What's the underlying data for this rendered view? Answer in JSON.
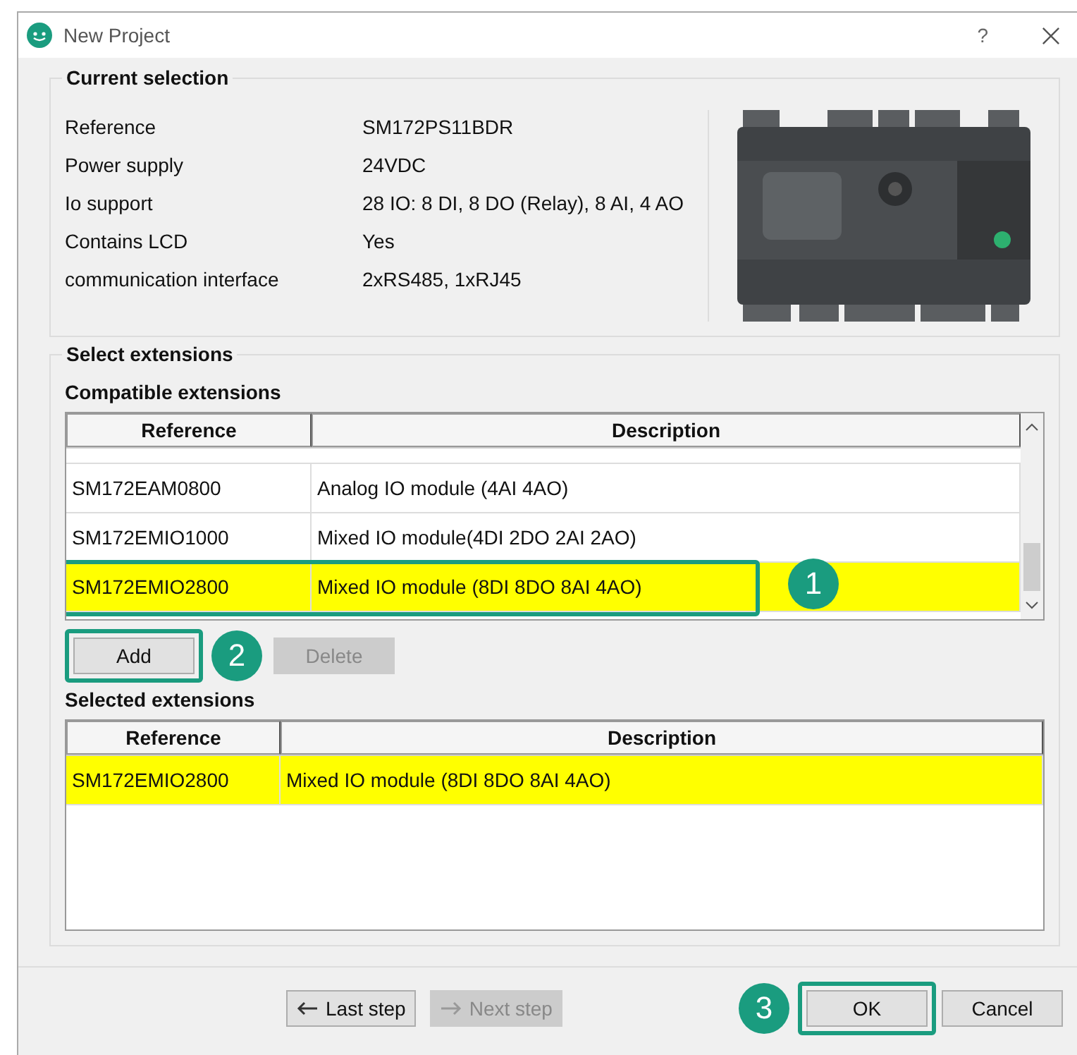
{
  "window": {
    "title": "New Project",
    "help": "?"
  },
  "current_selection": {
    "title": "Current selection",
    "fields": [
      {
        "label": "Reference",
        "value": "SM172PS11BDR"
      },
      {
        "label": "Power supply",
        "value": "24VDC"
      },
      {
        "label": "Io support",
        "value": "28 IO: 8 DI, 8 DO (Relay), 8 AI, 4 AO"
      },
      {
        "label": "Contains LCD",
        "value": "Yes"
      },
      {
        "label": "communication interface",
        "value": "2xRS485, 1xRJ45"
      }
    ]
  },
  "select_extensions": {
    "title": "Select extensions",
    "compatible": {
      "title": "Compatible extensions",
      "columns": [
        "Reference",
        "Description"
      ],
      "rows": [
        {
          "reference": "SM172EAM0800",
          "description": "Analog IO module (4AI 4AO)",
          "selected": false
        },
        {
          "reference": "SM172EMIO1000",
          "description": "Mixed IO module(4DI 2DO 2AI 2AO)",
          "selected": false
        },
        {
          "reference": "SM172EMIO2800",
          "description": "Mixed IO module (8DI 8DO 8AI 4AO)",
          "selected": true,
          "callout": "1"
        }
      ]
    },
    "buttons": [
      {
        "label": "Add",
        "disabled": false,
        "callout": "2"
      },
      {
        "label": "Delete",
        "disabled": true
      }
    ],
    "selected": {
      "title": "Selected extensions",
      "columns": [
        "Reference",
        "Description"
      ],
      "rows": [
        {
          "reference": "SM172EMIO2800",
          "description": "Mixed IO module (8DI 8DO 8AI 4AO)",
          "selected": true
        }
      ]
    }
  },
  "footer": {
    "nav": [
      {
        "label": "Last step",
        "kind": "back",
        "disabled": false
      },
      {
        "label": "Next step",
        "kind": "next",
        "disabled": true
      }
    ],
    "buttons": [
      {
        "label": "OK",
        "callout": "3"
      },
      {
        "label": "Cancel"
      }
    ]
  }
}
